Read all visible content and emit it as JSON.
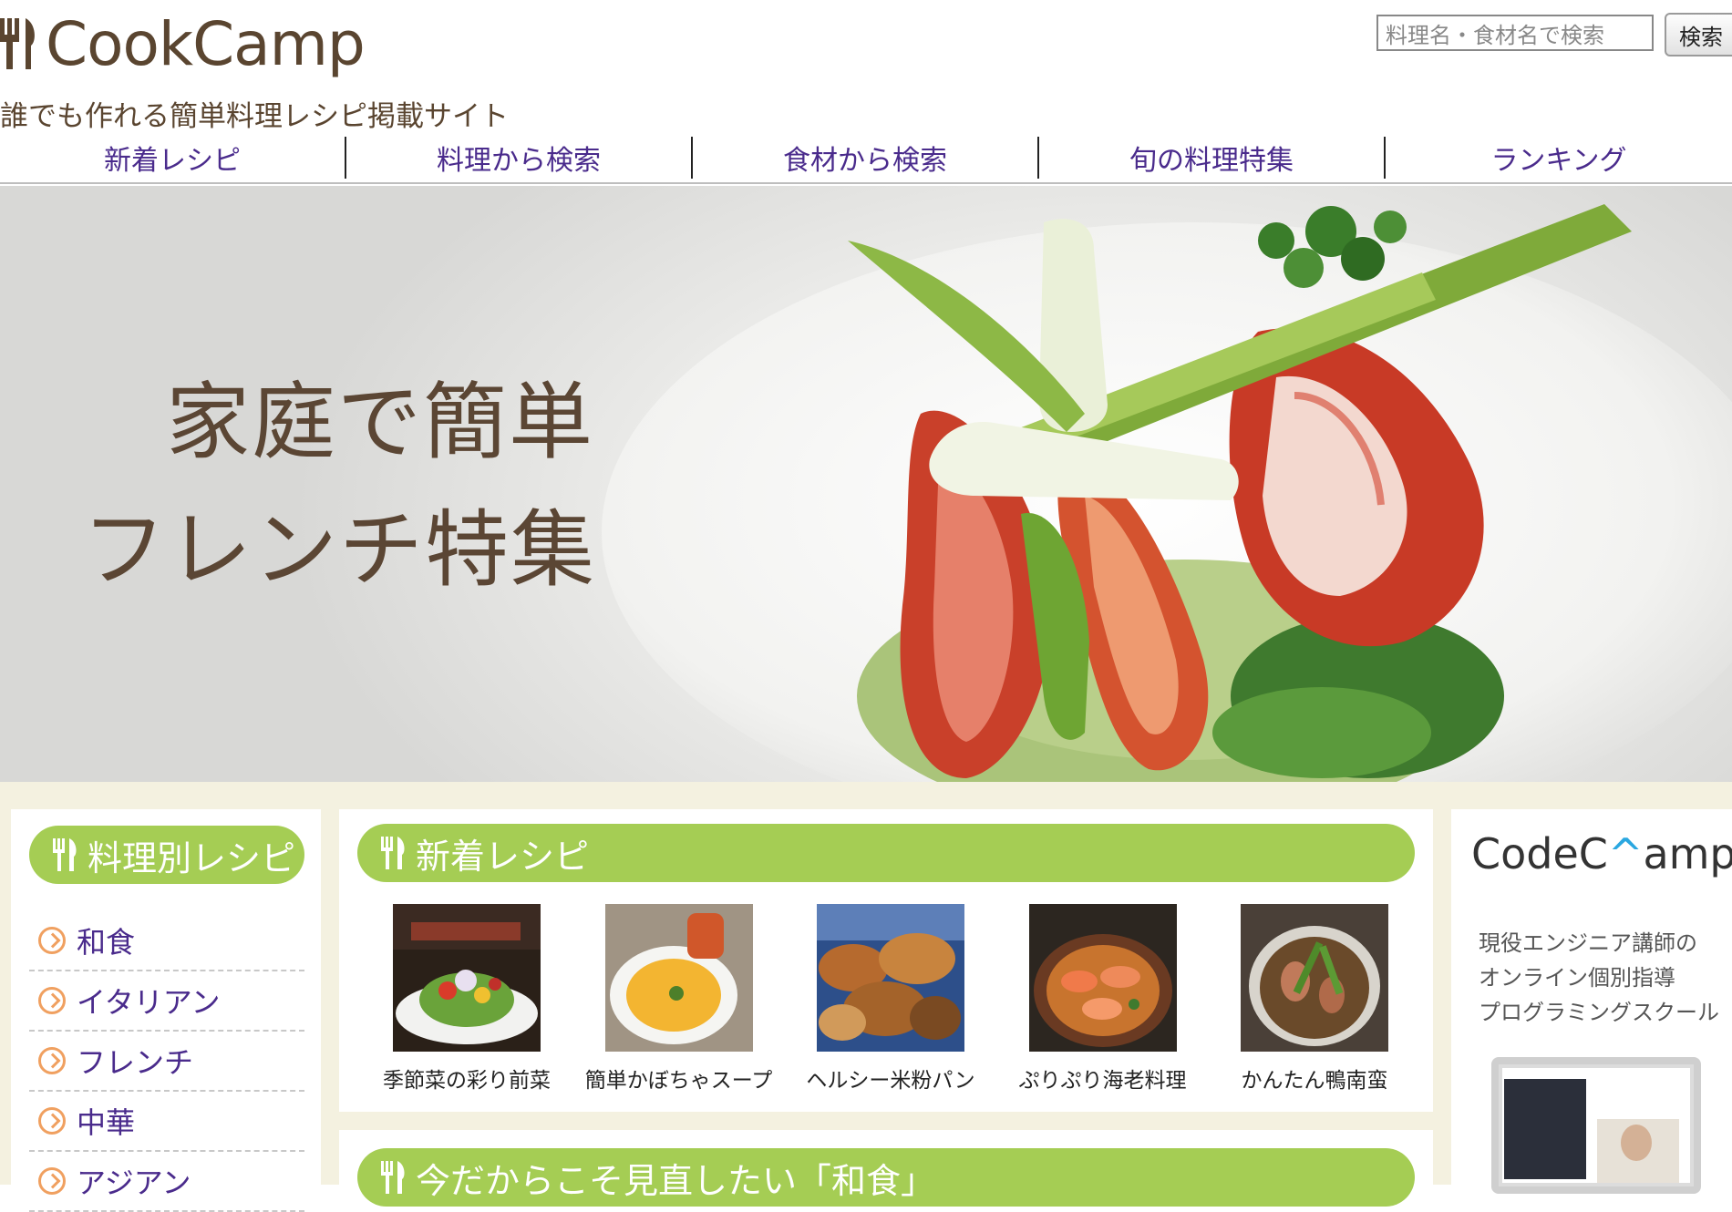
{
  "header": {
    "logo_text": "CookCamp",
    "tagline": "誰でも作れる簡単料理レシピ掲載サイト",
    "search_placeholder": "料理名・食材名で検索",
    "search_button": "検索"
  },
  "nav": {
    "items": [
      {
        "label": "新着レシピ"
      },
      {
        "label": "料理から検索"
      },
      {
        "label": "食材から検索"
      },
      {
        "label": "旬の料理特集"
      },
      {
        "label": "ランキング"
      }
    ]
  },
  "hero": {
    "line1": "家庭で簡単",
    "line2": "フレンチ特集"
  },
  "sidebar": {
    "heading": "料理別レシピ",
    "items": [
      {
        "label": "和食"
      },
      {
        "label": "イタリアン"
      },
      {
        "label": "フレンチ"
      },
      {
        "label": "中華"
      },
      {
        "label": "アジアン"
      }
    ]
  },
  "new_recipes": {
    "heading": "新着レシピ",
    "items": [
      {
        "name": "季節菜の彩り前菜",
        "icon": "appetizer-photo"
      },
      {
        "name": "簡単かぼちゃスープ",
        "icon": "pumpkin-soup-photo"
      },
      {
        "name": "ヘルシー米粉パン",
        "icon": "rice-bread-photo"
      },
      {
        "name": "ぷりぷり海老料理",
        "icon": "shrimp-dish-photo"
      },
      {
        "name": "かんたん鴨南蛮",
        "icon": "duck-soba-photo"
      }
    ]
  },
  "feature_section": {
    "heading": "今だからこそ見直したい「和食」"
  },
  "ad": {
    "logo_prefix": "CodeC",
    "logo_hat": "^",
    "logo_suffix": "amp",
    "line1": "現役エンジニア講師の",
    "line2": "オンライン個別指導",
    "line3": "プログラミングスクール"
  },
  "colors": {
    "accent_green": "#a5cd54",
    "nav_purple": "#4a2b8c",
    "brand_brown": "#5a4530",
    "bg_cream": "#f4f1e0",
    "arrow_orange": "#f0a060"
  }
}
